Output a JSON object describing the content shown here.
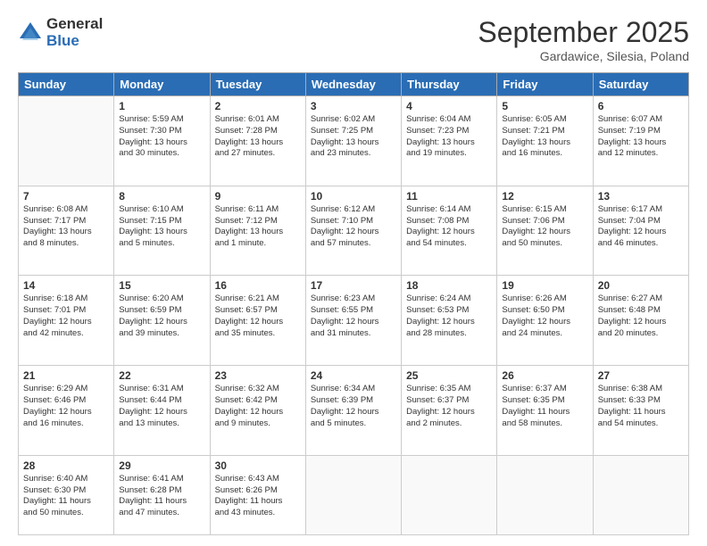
{
  "logo": {
    "general": "General",
    "blue": "Blue"
  },
  "header": {
    "month": "September 2025",
    "location": "Gardawice, Silesia, Poland"
  },
  "days": [
    "Sunday",
    "Monday",
    "Tuesday",
    "Wednesday",
    "Thursday",
    "Friday",
    "Saturday"
  ],
  "weeks": [
    [
      {
        "day": "",
        "content": ""
      },
      {
        "day": "1",
        "content": "Sunrise: 5:59 AM\nSunset: 7:30 PM\nDaylight: 13 hours\nand 30 minutes."
      },
      {
        "day": "2",
        "content": "Sunrise: 6:01 AM\nSunset: 7:28 PM\nDaylight: 13 hours\nand 27 minutes."
      },
      {
        "day": "3",
        "content": "Sunrise: 6:02 AM\nSunset: 7:25 PM\nDaylight: 13 hours\nand 23 minutes."
      },
      {
        "day": "4",
        "content": "Sunrise: 6:04 AM\nSunset: 7:23 PM\nDaylight: 13 hours\nand 19 minutes."
      },
      {
        "day": "5",
        "content": "Sunrise: 6:05 AM\nSunset: 7:21 PM\nDaylight: 13 hours\nand 16 minutes."
      },
      {
        "day": "6",
        "content": "Sunrise: 6:07 AM\nSunset: 7:19 PM\nDaylight: 13 hours\nand 12 minutes."
      }
    ],
    [
      {
        "day": "7",
        "content": "Sunrise: 6:08 AM\nSunset: 7:17 PM\nDaylight: 13 hours\nand 8 minutes."
      },
      {
        "day": "8",
        "content": "Sunrise: 6:10 AM\nSunset: 7:15 PM\nDaylight: 13 hours\nand 5 minutes."
      },
      {
        "day": "9",
        "content": "Sunrise: 6:11 AM\nSunset: 7:12 PM\nDaylight: 13 hours\nand 1 minute."
      },
      {
        "day": "10",
        "content": "Sunrise: 6:12 AM\nSunset: 7:10 PM\nDaylight: 12 hours\nand 57 minutes."
      },
      {
        "day": "11",
        "content": "Sunrise: 6:14 AM\nSunset: 7:08 PM\nDaylight: 12 hours\nand 54 minutes."
      },
      {
        "day": "12",
        "content": "Sunrise: 6:15 AM\nSunset: 7:06 PM\nDaylight: 12 hours\nand 50 minutes."
      },
      {
        "day": "13",
        "content": "Sunrise: 6:17 AM\nSunset: 7:04 PM\nDaylight: 12 hours\nand 46 minutes."
      }
    ],
    [
      {
        "day": "14",
        "content": "Sunrise: 6:18 AM\nSunset: 7:01 PM\nDaylight: 12 hours\nand 42 minutes."
      },
      {
        "day": "15",
        "content": "Sunrise: 6:20 AM\nSunset: 6:59 PM\nDaylight: 12 hours\nand 39 minutes."
      },
      {
        "day": "16",
        "content": "Sunrise: 6:21 AM\nSunset: 6:57 PM\nDaylight: 12 hours\nand 35 minutes."
      },
      {
        "day": "17",
        "content": "Sunrise: 6:23 AM\nSunset: 6:55 PM\nDaylight: 12 hours\nand 31 minutes."
      },
      {
        "day": "18",
        "content": "Sunrise: 6:24 AM\nSunset: 6:53 PM\nDaylight: 12 hours\nand 28 minutes."
      },
      {
        "day": "19",
        "content": "Sunrise: 6:26 AM\nSunset: 6:50 PM\nDaylight: 12 hours\nand 24 minutes."
      },
      {
        "day": "20",
        "content": "Sunrise: 6:27 AM\nSunset: 6:48 PM\nDaylight: 12 hours\nand 20 minutes."
      }
    ],
    [
      {
        "day": "21",
        "content": "Sunrise: 6:29 AM\nSunset: 6:46 PM\nDaylight: 12 hours\nand 16 minutes."
      },
      {
        "day": "22",
        "content": "Sunrise: 6:31 AM\nSunset: 6:44 PM\nDaylight: 12 hours\nand 13 minutes."
      },
      {
        "day": "23",
        "content": "Sunrise: 6:32 AM\nSunset: 6:42 PM\nDaylight: 12 hours\nand 9 minutes."
      },
      {
        "day": "24",
        "content": "Sunrise: 6:34 AM\nSunset: 6:39 PM\nDaylight: 12 hours\nand 5 minutes."
      },
      {
        "day": "25",
        "content": "Sunrise: 6:35 AM\nSunset: 6:37 PM\nDaylight: 12 hours\nand 2 minutes."
      },
      {
        "day": "26",
        "content": "Sunrise: 6:37 AM\nSunset: 6:35 PM\nDaylight: 11 hours\nand 58 minutes."
      },
      {
        "day": "27",
        "content": "Sunrise: 6:38 AM\nSunset: 6:33 PM\nDaylight: 11 hours\nand 54 minutes."
      }
    ],
    [
      {
        "day": "28",
        "content": "Sunrise: 6:40 AM\nSunset: 6:30 PM\nDaylight: 11 hours\nand 50 minutes."
      },
      {
        "day": "29",
        "content": "Sunrise: 6:41 AM\nSunset: 6:28 PM\nDaylight: 11 hours\nand 47 minutes."
      },
      {
        "day": "30",
        "content": "Sunrise: 6:43 AM\nSunset: 6:26 PM\nDaylight: 11 hours\nand 43 minutes."
      },
      {
        "day": "",
        "content": ""
      },
      {
        "day": "",
        "content": ""
      },
      {
        "day": "",
        "content": ""
      },
      {
        "day": "",
        "content": ""
      }
    ]
  ]
}
